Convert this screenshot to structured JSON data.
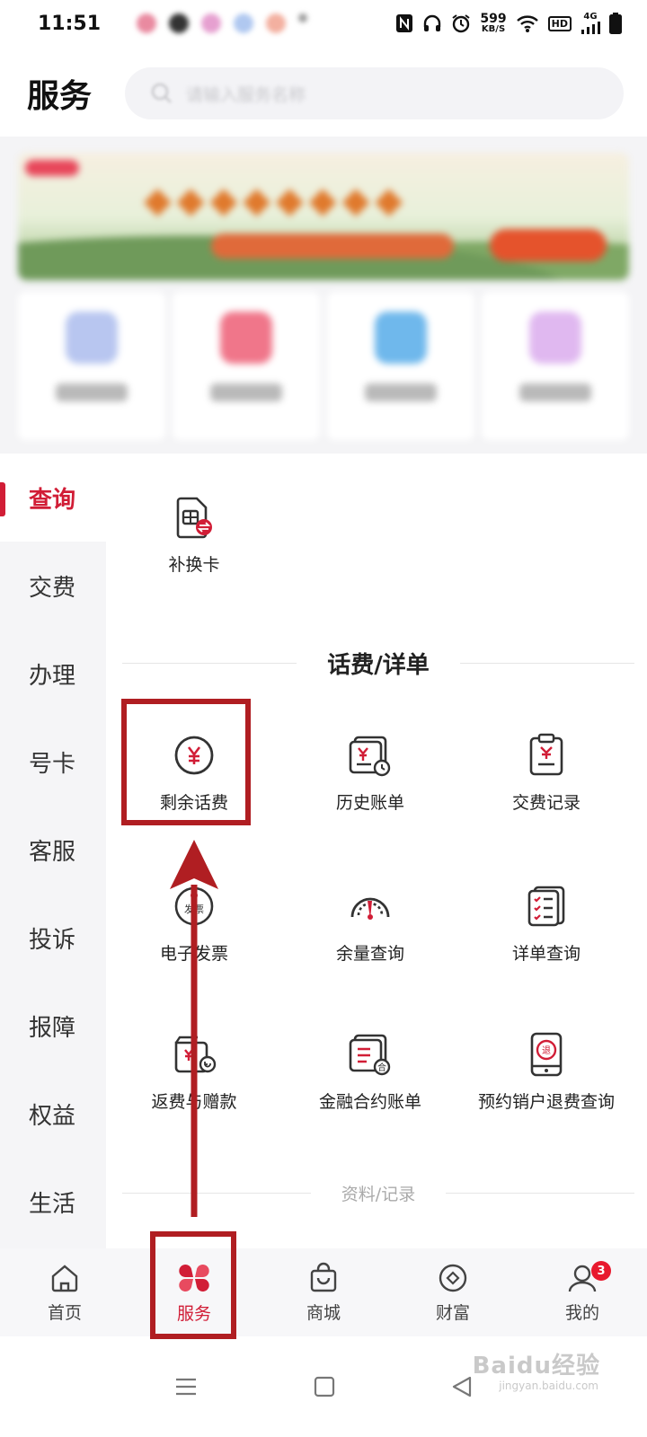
{
  "status_bar": {
    "time": "11:51",
    "net_speed_value": "599",
    "net_speed_unit": "KB/S",
    "hd": "HD",
    "signal": "4G"
  },
  "header": {
    "title": "服务",
    "search_placeholder": "请输入服务名称"
  },
  "side_nav": [
    {
      "label": "查询",
      "active": true
    },
    {
      "label": "交费",
      "active": false
    },
    {
      "label": "办理",
      "active": false
    },
    {
      "label": "号卡",
      "active": false
    },
    {
      "label": "客服",
      "active": false
    },
    {
      "label": "投诉",
      "active": false
    },
    {
      "label": "报障",
      "active": false
    },
    {
      "label": "权益",
      "active": false
    },
    {
      "label": "生活",
      "active": false
    }
  ],
  "top_service": {
    "label": "补换卡",
    "icon": "sim-card-swap-icon"
  },
  "section_bill": {
    "title": "话费/详单",
    "items": [
      {
        "label": "剩余话费",
        "icon": "yuan-circle-icon"
      },
      {
        "label": "历史账单",
        "icon": "bill-history-icon"
      },
      {
        "label": "交费记录",
        "icon": "payment-record-icon"
      },
      {
        "label": "电子发票",
        "icon": "e-invoice-icon",
        "icon_text": "发票"
      },
      {
        "label": "余量查询",
        "icon": "gauge-icon"
      },
      {
        "label": "详单查询",
        "icon": "checklist-icon"
      },
      {
        "label": "返费与赠款",
        "icon": "refund-wallet-icon"
      },
      {
        "label": "金融合约账单",
        "icon": "contract-bill-icon",
        "icon_text": "合"
      },
      {
        "label": "预约销户退费查询",
        "icon": "refund-phone-icon",
        "icon_text": "退"
      }
    ]
  },
  "section_records": {
    "title": "资料/记录"
  },
  "tab_bar": [
    {
      "label": "首页",
      "icon": "home-icon",
      "active": false
    },
    {
      "label": "服务",
      "icon": "clover-icon",
      "active": true
    },
    {
      "label": "商城",
      "icon": "shopping-bag-icon",
      "active": false
    },
    {
      "label": "财富",
      "icon": "diamond-icon",
      "active": false
    },
    {
      "label": "我的",
      "icon": "person-icon",
      "active": false,
      "badge": "3"
    }
  ],
  "watermark": {
    "brand": "Baidu经验",
    "url": "jingyan.baidu.com"
  },
  "colors": {
    "accent": "#d11d36",
    "annotation": "#b01e22",
    "sidebar_bg": "#f5f5f7"
  }
}
